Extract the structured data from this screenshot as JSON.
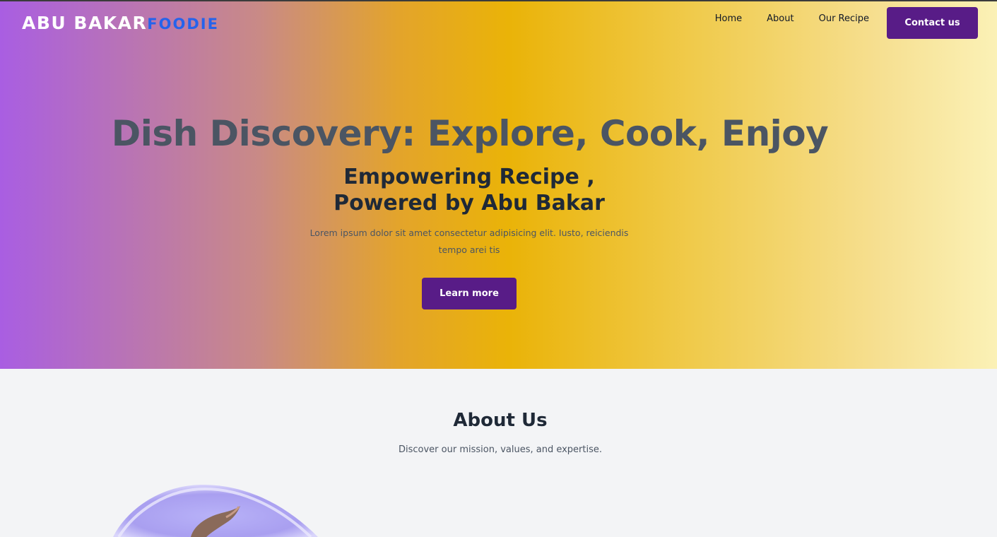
{
  "brand": {
    "name_main": "ABU BAKAR",
    "name_accent": "FOODIE"
  },
  "nav": {
    "items": [
      "Home",
      "About",
      "Our Recipe"
    ],
    "contact_label": "Contact us"
  },
  "hero": {
    "title": "Dish Discovery: Explore, Cook, Enjoy",
    "subtitle": "Empowering Recipe , Powered by Abu Bakar",
    "description": "Lorem ipsum dolor sit amet consectetur adipisicing elit. Iusto, reiciendis tempo arei tis",
    "cta_label": "Learn more"
  },
  "about": {
    "title": "About Us",
    "subtitle": "Discover our mission, values, and expertise."
  },
  "colors": {
    "accent_purple": "#581c87",
    "brand_blue": "#2563eb",
    "gradient_start": "#a95ee2",
    "gradient_mid": "#eab308",
    "gradient_end": "#fbf1b6"
  },
  "images": {
    "about_image": "food-bowl-image"
  }
}
